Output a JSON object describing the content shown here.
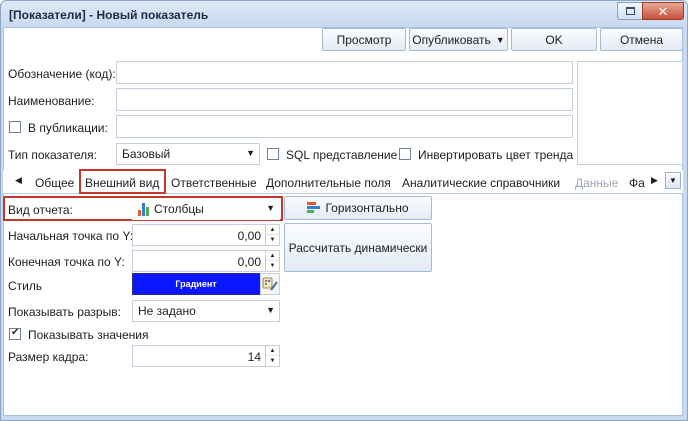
{
  "window": {
    "title": "[Показатели] - Новый показатель",
    "close_glyph": "✕"
  },
  "toolbar": {
    "preview_label": "Просмотр",
    "publish_label": "Опубликовать",
    "ok_label": "OK",
    "cancel_label": "Отмена"
  },
  "form": {
    "code_label": "Обозначение (код):",
    "code_value": "",
    "name_label": "Наименование:",
    "name_value": "",
    "published_label": "В публикации:",
    "published_checked": false,
    "published_value": "",
    "type_label": "Тип показателя:",
    "type_value": "Базовый",
    "sql_label": "SQL представление",
    "sql_checked": false,
    "invert_label": "Инвертировать цвет тренда",
    "invert_checked": false
  },
  "tabs": [
    {
      "label": "Общее",
      "active": false,
      "disabled": false
    },
    {
      "label": "Внешний вид",
      "active": true,
      "disabled": false
    },
    {
      "label": "Ответственные",
      "active": false,
      "disabled": false
    },
    {
      "label": "Дополнительные поля",
      "active": false,
      "disabled": false
    },
    {
      "label": "Аналитические справочники",
      "active": false,
      "disabled": false
    },
    {
      "label": "Данные",
      "active": false,
      "disabled": true
    },
    {
      "label": "Фа",
      "active": false,
      "disabled": false
    }
  ],
  "appearance": {
    "report_type_label": "Вид отчета:",
    "report_type_value": "Столбцы",
    "horizontal_label": "Горизонтально",
    "start_y_label": "Начальная точка по Y:",
    "start_y_value": "0,00",
    "end_y_label": "Конечная точка по Y:",
    "end_y_value": "0,00",
    "calc_dynamic_label": "Рассчитать динамически",
    "style_label": "Стиль",
    "style_value": "Градиент",
    "style_color": "#0a16ff",
    "show_gap_label": "Показывать разрыв:",
    "show_gap_value": "Не задано",
    "show_values_label": "Показывать значения",
    "show_values_checked": true,
    "frame_size_label": "Размер кадра:",
    "frame_size_value": "14"
  },
  "colors": {
    "window_frame": "#c9daf0",
    "highlight_frame": "#c0392b",
    "close_button": "#c8503a"
  }
}
